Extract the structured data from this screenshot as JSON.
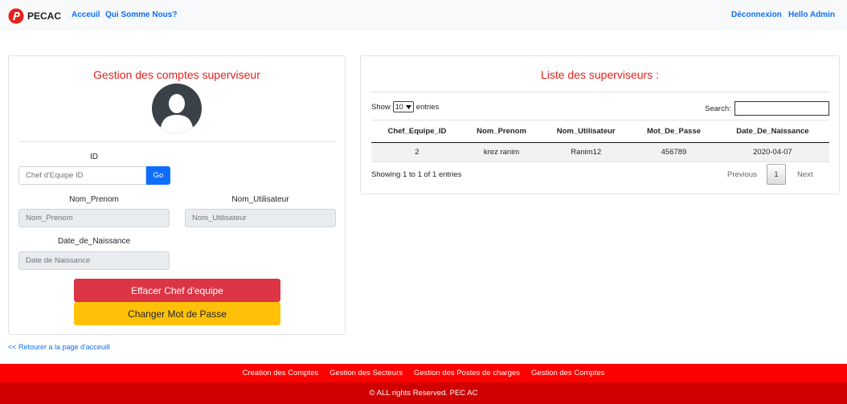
{
  "nav": {
    "brand": "PECAC",
    "links": [
      "Acceuil",
      "Qui Somme Nous?"
    ],
    "right_links": [
      "Déconnexion",
      "Hello Admin"
    ]
  },
  "left_panel": {
    "title": "Gestion des comptes superviseur",
    "avatar_icon": "user-avatar-icon",
    "id_label": "ID",
    "id_placeholder": "Chef d'Equipe ID",
    "go_label": "Go",
    "nom_prenom_label": "Nom_Prenom",
    "nom_prenom_placeholder": "Nom_Prenom",
    "nom_utilisateur_label": "Nom_Utilisateur",
    "nom_utilisateur_placeholder": "Nom_Utilisateur",
    "date_label": "Date_de_Naissance",
    "date_placeholder": "Date de Naissance",
    "delete_button": "Effacer Chef d'equipe",
    "change_pwd_button": "Changer Mot de Passe"
  },
  "back_link": "<< Retourer a la page d'acceuill",
  "right_panel": {
    "title": "Liste des superviseurs :",
    "show_label": "Show",
    "show_value": "10",
    "entries_label": "entries",
    "search_label": "Search:",
    "columns": [
      "Chef_Equipe_ID",
      "Nom_Prenom",
      "Nom_Utilisateur",
      "Mot_De_Passe",
      "Date_De_Naissance"
    ],
    "rows": [
      [
        "2",
        "krez ranim",
        "Ranim12",
        "456789",
        "2020-04-07"
      ]
    ],
    "info": "Showing 1 to 1 of 1 entries",
    "prev": "Previous",
    "current_page": "1",
    "next": "Next"
  },
  "footer": {
    "links": [
      "Creation des Comptes",
      "Gestion des Secteurs",
      "Gestion des Postes de charges",
      "Gestion des Comptes"
    ],
    "copyright": "© ALL rights Reserved. PEC AC"
  },
  "colors": {
    "accent_red": "#e8201c",
    "link_blue": "#0d6efd",
    "footer_red": "#ff0000",
    "button_red": "#dc3545",
    "button_yellow": "#ffc107"
  }
}
